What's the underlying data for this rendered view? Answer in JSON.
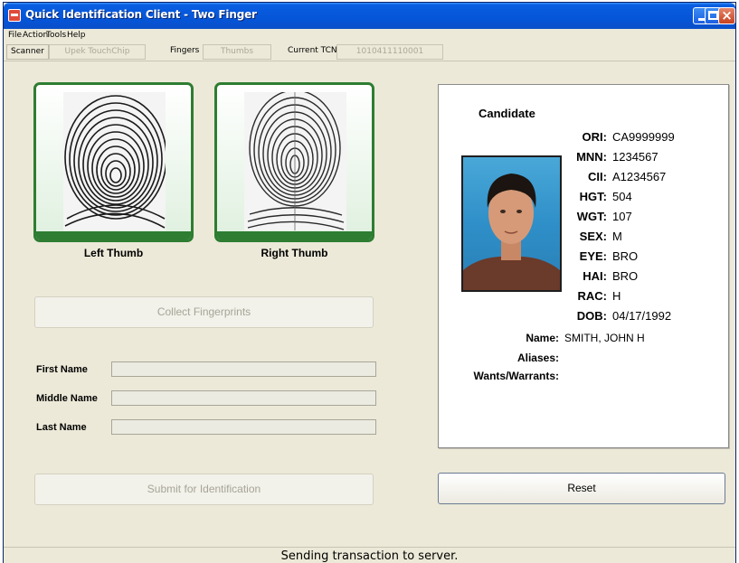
{
  "window": {
    "title": "Quick Identification Client - Two Finger"
  },
  "menu": {
    "items": [
      "File",
      "Action",
      "Tools",
      "Help"
    ]
  },
  "toolbar": {
    "scanner_label": "Scanner",
    "scanner_value": "Upek TouchChip",
    "fingers_label": "Fingers",
    "fingers_value": "Thumbs",
    "tcn_label": "Current TCN",
    "tcn_value": "1010411110001"
  },
  "prints": {
    "left_label": "Left Thumb",
    "right_label": "Right Thumb"
  },
  "buttons": {
    "collect": "Collect Fingerprints",
    "submit": "Submit for Identification",
    "reset": "Reset"
  },
  "form": {
    "first_name_label": "First Name",
    "first_name_value": "",
    "middle_name_label": "Middle Name",
    "middle_name_value": "",
    "last_name_label": "Last Name",
    "last_name_value": ""
  },
  "candidate": {
    "title": "Candidate",
    "fields": [
      {
        "key": "ORI:",
        "value": "CA9999999"
      },
      {
        "key": "MNN:",
        "value": "1234567"
      },
      {
        "key": "CII:",
        "value": "A1234567"
      },
      {
        "key": "HGT:",
        "value": "504"
      },
      {
        "key": "WGT:",
        "value": "107"
      },
      {
        "key": "SEX:",
        "value": "M"
      },
      {
        "key": "EYE:",
        "value": "BRO"
      },
      {
        "key": "HAI:",
        "value": "BRO"
      },
      {
        "key": "RAC:",
        "value": "H"
      },
      {
        "key": "DOB:",
        "value": "04/17/1992"
      }
    ],
    "name_label": "Name:",
    "name_value": "SMITH, JOHN H",
    "aliases_label": "Aliases:",
    "aliases_value": "",
    "warrants_label": "Wants/Warrants:",
    "warrants_value": ""
  },
  "status": {
    "text": "Sending transaction to server."
  }
}
